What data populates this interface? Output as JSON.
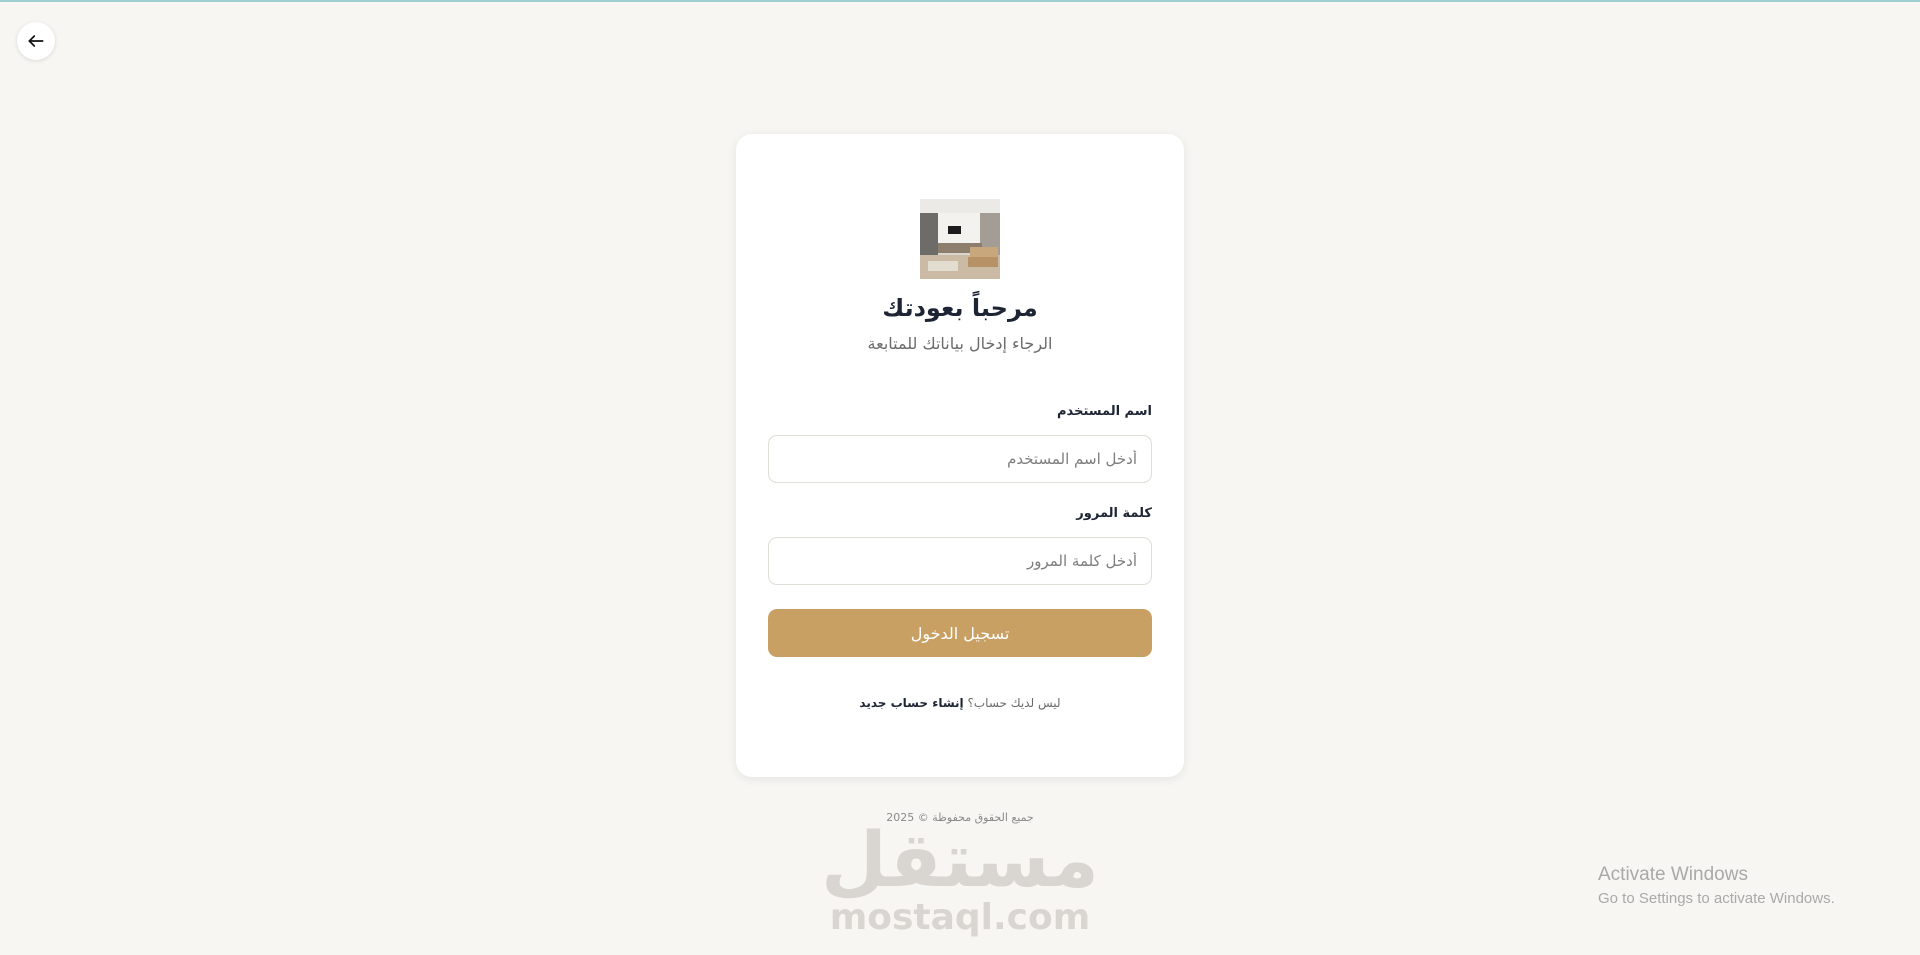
{
  "nav": {
    "back_icon": "arrow-left-icon"
  },
  "login": {
    "logo_alt": "",
    "welcome_title": "مرحباً بعودتك",
    "subtitle": "الرجاء إدخال بياناتك للمتابعة",
    "username_label": "اسم المستخدم",
    "username_placeholder": "أدخل اسم المستخدم",
    "username_value": "",
    "password_label": "كلمة المرور",
    "password_placeholder": "أدخل كلمة المرور",
    "password_value": "",
    "login_button": "تسجيل الدخول",
    "no_account_text": "ليس لديك حساب؟",
    "signup_link": "إنشاء حساب جديد"
  },
  "footer": {
    "copyright": "جميع الحقوق محفوظة © 2025"
  },
  "watermark": {
    "arabic": "مستقل",
    "english": "mostaql.com"
  },
  "os_overlay": {
    "title": "Activate Windows",
    "subtitle": "Go to Settings to activate Windows."
  },
  "colors": {
    "background": "#f7f6f3",
    "accent": "#c8a063",
    "text_dark": "#1d2433",
    "text_muted": "#6b6b6b"
  }
}
